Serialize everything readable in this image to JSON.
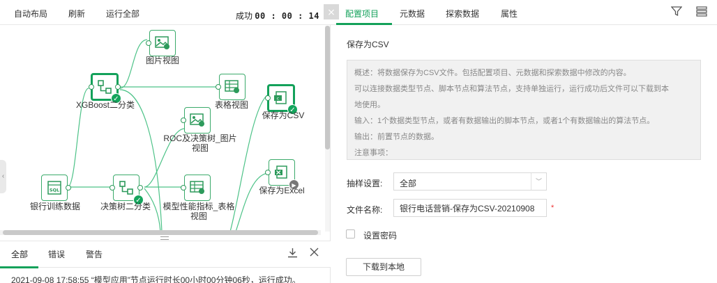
{
  "toolbar": {
    "auto_layout": "自动布局",
    "refresh": "刷新",
    "run_all": "运行全部",
    "status_label": "成功",
    "elapsed": "00 : 00 : 14"
  },
  "nodes": {
    "xgboost": "XGBoost二分类",
    "image_view": "图片视图",
    "table_view": "表格视图",
    "save_csv": "保存为CSV",
    "roc_line1": "ROC及决策树_图片",
    "roc_line2": "视图",
    "save_excel": "保存为Excel",
    "bank_data": "银行训练数据",
    "decision_tree": "决策树二分类",
    "metrics_line1": "模型性能指标_表格",
    "metrics_line2": "视图"
  },
  "log": {
    "tabs": [
      "全部",
      "错误",
      "警告"
    ],
    "line": "2021-09-08 17:58:55 “模型应用”节点运行时长00小时00分钟06秒，运行成功。"
  },
  "right_tabs": [
    "配置项目",
    "元数据",
    "探索数据",
    "属性"
  ],
  "config": {
    "section_title": "保存为CSV",
    "desc": [
      "概述：将数据保存为CSV文件。包括配置项目、元数据和探索数据中修改的内容。",
      "可以连接数据类型节点、脚本节点和算法节点，支持单独运行，运行成功后文件可以下载到本",
      "地使用。",
      "输入：1个数据类型节点，或者有数据输出的脚本节点，或者1个有数据输出的算法节点。",
      "输出：前置节点的数据。",
      "注意事项："
    ],
    "sampling_label": "抽样设置:",
    "sampling_value": "全部",
    "filename_label": "文件名称:",
    "filename_value": "银行电话营销-保存为CSV-20210908",
    "required_mark": "*",
    "password_label": "设置密码",
    "download_button": "下载到本地"
  },
  "colors": {
    "accent": "#13a15a",
    "edge": "#4cc287"
  }
}
